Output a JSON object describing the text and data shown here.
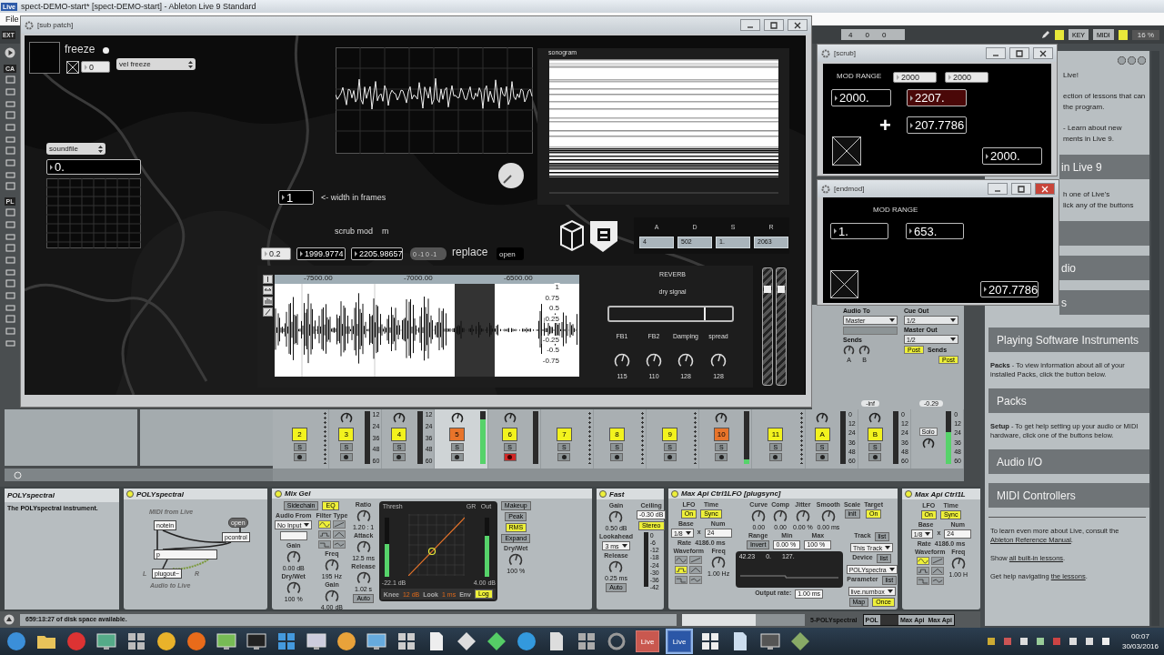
{
  "app": {
    "badge": "Live",
    "title": "spect-DEMO-start*  [spect-DEMO-start] - Ableton Live 9 Standard",
    "menu": [
      "File"
    ]
  },
  "control_bar": {
    "ext": "EXT",
    "counters": [
      "4",
      "0",
      "0"
    ],
    "key": "KEY",
    "midi": "MIDI",
    "cpu": "16 %"
  },
  "left_strip": {
    "labels": [
      "CA",
      "PL"
    ]
  },
  "sub_patch": {
    "title": "[sub patch]",
    "freeze": {
      "label": "freeze",
      "toggle": {
        "checked": true
      },
      "number": "0",
      "menu": "vel freeze"
    },
    "soundfile": {
      "menu": "soundfile",
      "number": "0."
    },
    "sonogram": {
      "label": "sonogram"
    },
    "width": {
      "number": "1",
      "label": "<- width in frames"
    },
    "scrub_mod": {
      "label": "scrub mod",
      "key": "m"
    },
    "numbers": [
      "0.2",
      "1999.9774",
      "2205.98657"
    ],
    "message": "0 -1 0 -1",
    "replace": "replace",
    "open": "open",
    "adsr": [
      {
        "label": "A",
        "value": "4"
      },
      {
        "label": "D",
        "value": "502"
      },
      {
        "label": "S",
        "value": "1."
      },
      {
        "label": "R",
        "value": "2063"
      }
    ],
    "waveform": {
      "ruler": [
        "-7500.00",
        "-7000.00",
        "-6500.00"
      ],
      "scale": [
        "1",
        "0.75",
        "0.5",
        "0.25",
        "-0.25",
        "-0.5",
        "-0.75"
      ]
    },
    "reverb": {
      "title": "REVERB",
      "slider_label": "dry signal",
      "level": 0.77,
      "knobs": [
        {
          "label": "FB1",
          "value": "115"
        },
        {
          "label": "FB2",
          "value": "110"
        },
        {
          "label": "Damping",
          "value": "128"
        },
        {
          "label": "spread",
          "value": "128"
        }
      ]
    },
    "faders": [
      {
        "level": 0.84
      },
      {
        "level": 0.84
      }
    ]
  },
  "scrub": {
    "title": "[scrub]",
    "label": "MOD RANGE",
    "inputs": [
      "2000",
      "2000"
    ],
    "operator": "+",
    "numbers": [
      {
        "value": "2000.",
        "selected": false
      },
      {
        "value": "2207.",
        "selected": true
      },
      {
        "value": "207.7786",
        "selected": false
      },
      {
        "value": "2000.",
        "selected": false
      }
    ]
  },
  "endmod": {
    "title": "[endmod]",
    "label": "MOD RANGE",
    "numbers": [
      "1.",
      "653.",
      "207.7786"
    ]
  },
  "mixer": {
    "io": {
      "audio_to": {
        "label": "Audio To",
        "value": "Master"
      },
      "sends": "Sends",
      "send_knobs": [
        "A",
        "B"
      ],
      "volume": "-inf",
      "cue_out": {
        "label": "Cue Out",
        "value": "1/2"
      },
      "master_out": {
        "label": "Master Out",
        "value": "1/2"
      },
      "post": [
        "Post",
        "Post"
      ],
      "master_sends": "Sends",
      "master_volume": "-0.29"
    },
    "tracks": [
      {
        "number": "2",
        "color": "#f2f21e",
        "selected": false,
        "armed": false,
        "solo": "S",
        "knob": false
      },
      {
        "number": "3",
        "color": "#f2f21e",
        "selected": false,
        "armed": false,
        "solo": "S",
        "knob": true,
        "level": 0,
        "scale": [
          "12",
          "24",
          "36",
          "48",
          "60"
        ]
      },
      {
        "number": "4",
        "color": "#f2f21e",
        "selected": false,
        "armed": false,
        "solo": "S",
        "knob": true,
        "level": 0,
        "scale": [
          "12",
          "24",
          "36",
          "48",
          "60"
        ]
      },
      {
        "number": "5",
        "color": "#e8742a",
        "selected": true,
        "armed": false,
        "solo": "S",
        "knob": true,
        "level": 0.85
      },
      {
        "number": "6",
        "color": "#f2f21e",
        "selected": false,
        "armed": true,
        "solo": "S",
        "knob": true,
        "level": 0
      },
      {
        "number": "7",
        "color": "#f2f21e",
        "selected": false,
        "armed": false,
        "solo": "S",
        "knob": false
      },
      {
        "number": "8",
        "color": "#f2f21e",
        "selected": false,
        "armed": false,
        "solo": "S",
        "knob": false
      },
      {
        "number": "9",
        "color": "#f2f21e",
        "selected": false,
        "armed": false,
        "solo": "S",
        "knob": false
      },
      {
        "number": "10",
        "color": "#e8742a",
        "selected": false,
        "armed": false,
        "solo": "S",
        "knob": true,
        "level": 0.08
      },
      {
        "number": "11",
        "color": "#f2f21e",
        "selected": false,
        "armed": false,
        "solo": "S",
        "knob": false
      },
      {
        "number": "A",
        "color": "#f2f21e",
        "selected": false,
        "armed": false,
        "solo": "S",
        "knob": true,
        "level": 0,
        "scale": [
          "0",
          "12",
          "24",
          "36",
          "48",
          "60"
        ]
      },
      {
        "number": "B",
        "color": "#f2f21e",
        "selected": false,
        "armed": false,
        "solo": "S",
        "knob": true,
        "level": 0,
        "scale": [
          "0",
          "12",
          "24",
          "36",
          "48",
          "60"
        ]
      }
    ],
    "master": {
      "solo": "Solo",
      "level": 0.6,
      "scale": [
        "0",
        "12",
        "24",
        "36",
        "48",
        "60"
      ]
    }
  },
  "help": {
    "upper": [
      {
        "kind": "text",
        "lines": [
          "Live!"
        ]
      },
      {
        "kind": "text",
        "lines": [
          "ection of lessons that can",
          "the program."
        ]
      },
      {
        "kind": "text",
        "lines": [
          "- Learn about new",
          "ments in Live 9."
        ]
      },
      {
        "kind": "header",
        "text": "in Live 9"
      },
      {
        "kind": "text",
        "lines": [
          "h one of Live's",
          "lick any of the buttons"
        ]
      },
      {
        "kind": "header"
      },
      {
        "kind": "header",
        "text": "dio"
      },
      {
        "kind": "header",
        "text": "s"
      }
    ],
    "lower": [
      {
        "kind": "header",
        "text": "Playing Software Instruments"
      },
      {
        "kind": "para",
        "text": "**Packs** - To view information about all of your installed Packs, click the button below."
      },
      {
        "kind": "header",
        "text": "Packs"
      },
      {
        "kind": "para",
        "text": "**Setup** - To get help setting up your audio or MIDI hardware, click one of the buttons below."
      },
      {
        "kind": "header",
        "text": "Audio I/O"
      },
      {
        "kind": "header",
        "text": "MIDI Controllers"
      },
      {
        "kind": "link",
        "before": "To learn even more about Live, consult the",
        "link": "Ableton Reference Manual",
        "after": "."
      },
      {
        "kind": "link",
        "before": "Show",
        "link": "all built-in lessons",
        "after": "."
      },
      {
        "kind": "link",
        "before": "Get help navigating",
        "link": "the lessons",
        "after": "."
      }
    ]
  },
  "devices": {
    "info": {
      "title": "POLYspectral",
      "text": "The POLYspectral instrument."
    },
    "list": [
      {
        "title": "POLYspectral",
        "body": {
          "kind": "patch",
          "objects": [
            "MIDI from Live",
            "notein",
            "open",
            "pcontrol",
            "p",
            "L",
            "plugout~",
            "R",
            "Audio to Live"
          ]
        }
      },
      {
        "title": "Mix Gel",
        "body": {
          "kind": "row",
          "items": [
            {
              "kind": "stack",
              "items": [
                {
                  "kind": "row",
                  "items": [
                    {
                      "kind": "button",
                      "text": "Sidechain",
                      "on": false
                    },
                    {
                      "kind": "button",
                      "text": "EQ",
                      "on": true
                    }
                  ]
                },
                {
                  "kind": "row",
                  "items": [
                    {
                      "kind": "stack",
                      "items": [
                        {
                          "kind": "label",
                          "text": "Audio From"
                        },
                        {
                          "kind": "menu",
                          "value": "No Input"
                        },
                        {
                          "kind": "field"
                        },
                        {
                          "kind": "label",
                          "text": "Gain"
                        },
                        {
                          "kind": "knob",
                          "value": "0.00 dB"
                        },
                        {
                          "kind": "label",
                          "text": "Dry/Wet"
                        },
                        {
                          "kind": "knob",
                          "value": "100 %"
                        }
                      ]
                    },
                    {
                      "kind": "stack",
                      "items": [
                        {
                          "kind": "label",
                          "text": "Filter Type"
                        },
                        {
                          "kind": "icons",
                          "buttons": [
                            {
                              "selected": true
                            },
                            {
                              "selected": false
                            },
                            {
                              "selected": false
                            },
                            {
                              "selected": false
                            },
                            {
                              "selected": false
                            },
                            {
                              "selected": false
                            }
                          ]
                        },
                        {
                          "kind": "label",
                          "text": "Freq"
                        },
                        {
                          "kind": "knob",
                          "value": "195 Hz"
                        },
                        {
                          "kind": "label",
                          "text": "Gain"
                        },
                        {
                          "kind": "knob",
                          "value": "4.00 dB"
                        }
                      ]
                    }
                  ]
                }
              ]
            },
            {
              "kind": "stack",
              "items": [
                {
                  "kind": "label",
                  "text": "Ratio"
                },
                {
                  "kind": "knob",
                  "value": "1.20 : 1"
                },
                {
                  "kind": "label",
                  "text": "Attack"
                },
                {
                  "kind": "knob",
                  "value": "12.5 ms"
                },
                {
                  "kind": "label",
                  "text": "Release"
                },
                {
                  "kind": "knob",
                  "value": "1.02 s"
                },
                {
                  "kind": "button",
                  "text": "Auto",
                  "on": false
                }
              ]
            },
            {
              "kind": "graph",
              "labels": [
                "Thresh",
                "GR",
                "Out"
              ],
              "in_value": "-22.1 dB",
              "out_value": "4.00 dB",
              "meters": [
                {
                  "level": 0.55
                },
                {
                  "level": 0.7
                }
              ],
              "footer": [
                {
                  "kind": "label",
                  "text": "Knee"
                },
                {
                  "kind": "value",
                  "text": "12 dB"
                },
                {
                  "kind": "label",
                  "text": "Look"
                },
                {
                  "kind": "value",
                  "text": "1 ms"
                },
                {
                  "kind": "label",
                  "text": "Env"
                },
                {
                  "kind": "button",
                  "text": "Log",
                  "on": true
                }
              ]
            },
            {
              "kind": "stack",
              "items": [
                {
                  "kind": "button",
                  "text": "Makeup",
                  "on": false
                },
                {
                  "kind": "button",
                  "text": "Peak",
                  "on": false
                },
                {
                  "kind": "button",
                  "text": "RMS",
                  "on": true
                },
                {
                  "kind": "button",
                  "text": "Expand",
                  "on": false
                },
                {
                  "kind": "label",
                  "text": "Dry/Wet"
                },
                {
                  "kind": "knob",
                  "value": "100 %"
                }
              ]
            }
          ]
        }
      },
      {
        "title": "Fast",
        "body": {
          "kind": "row",
          "items": [
            {
              "kind": "stack",
              "items": [
                {
                  "kind": "label",
                  "text": "Gain"
                },
                {
                  "kind": "knob",
                  "value": "0.50 dB"
                },
                {
                  "kind": "label",
                  "text": "Lookahead"
                },
                {
                  "kind": "menu",
                  "value": "3 ms"
                },
                {
                  "kind": "label",
                  "text": "Release"
                },
                {
                  "kind": "knob",
                  "value": "0.25 ms"
                },
                {
                  "kind": "button",
                  "text": "Auto",
                  "on": false
                }
              ]
            },
            {
              "kind": "stack",
              "items": [
                {
                  "kind": "label",
                  "text": "Ceiling"
                },
                {
                  "kind": "field",
                  "value": "-0.30 dB"
                },
                {
                  "kind": "button",
                  "text": "Stereo",
                  "on": true
                },
                {
                  "kind": "meter",
                  "level": 0,
                  "scale": [
                    "0",
                    "-6",
                    "-12",
                    "-18",
                    "-24",
                    "-30",
                    "-36",
                    "-42"
                  ]
                }
              ]
            }
          ]
        }
      },
      {
        "title": "Max Api Ctrl1LFO [plugsync]",
        "body": {
          "kind": "row",
          "items": [
            {
              "kind": "stack",
              "items": [
                {
                  "kind": "row",
                  "items": [
                    {
                      "kind": "stack",
                      "items": [
                        {
                          "kind": "label",
                          "text": "LFO"
                        },
                        {
                          "kind": "button",
                          "text": "On",
                          "on": true
                        }
                      ]
                    },
                    {
                      "kind": "stack",
                      "items": [
                        {
                          "kind": "label",
                          "text": "Time"
                        },
                        {
                          "kind": "button",
                          "text": "Sync",
                          "on": true
                        }
                      ]
                    }
                  ]
                },
                {
                  "kind": "row",
                  "items": [
                    {
                      "kind": "stack",
                      "items": [
                        {
                          "kind": "label",
                          "text": "Base"
                        },
                        {
                          "kind": "row",
                          "items": [
                            {
                              "kind": "menu",
                              "value": "1/8"
                            },
                            {
                              "kind": "label",
                              "text": "x"
                            }
                          ]
                        }
                      ]
                    },
                    {
                      "kind": "stack",
                      "items": [
                        {
                          "kind": "label",
                          "text": "Num"
                        },
                        {
                          "kind": "field",
                          "value": "24"
                        }
                      ]
                    }
                  ]
                },
                {
                  "kind": "row",
                  "items": [
                    {
                      "kind": "label",
                      "text": "Rate"
                    },
                    {
                      "kind": "label",
                      "text": "4186.0 ms"
                    }
                  ]
                },
                {
                  "kind": "row",
                  "items": [
                    {
                      "kind": "stack",
                      "items": [
                        {
                          "kind": "label",
                          "text": "Waveform"
                        },
                        {
                          "kind": "icons",
                          "buttons": [
                            {
                              "selected": false
                            },
                            {
                              "selected": false
                            },
                            {
                              "selected": true
                            },
                            {
                              "selected": false
                            },
                            {
                              "selected": false
                            },
                            {
                              "selected": false
                            }
                          ]
                        }
                      ]
                    },
                    {
                      "kind": "stack",
                      "items": [
                        {
                          "kind": "label",
                          "text": "Freq"
                        },
                        {
                          "kind": "knob",
                          "value": "1.00 Hz"
                        }
                      ]
                    }
                  ]
                }
              ]
            },
            {
              "kind": "stack",
              "items": [
                {
                  "kind": "row",
                  "items": [
                    {
                      "kind": "stack",
                      "items": [
                        {
                          "kind": "label",
                          "text": "Curve"
                        },
                        {
                          "kind": "knob",
                          "value": "0.00"
                        }
                      ]
                    },
                    {
                      "kind": "stack",
                      "items": [
                        {
                          "kind": "label",
                          "text": "Comp"
                        },
                        {
                          "kind": "knob",
                          "value": "0.00"
                        }
                      ]
                    },
                    {
                      "kind": "stack",
                      "items": [
                        {
                          "kind": "label",
                          "text": "Jitter"
                        },
                        {
                          "kind": "knob",
                          "value": "0.00 %"
                        }
                      ]
                    },
                    {
                      "kind": "stack",
                      "items": [
                        {
                          "kind": "label",
                          "text": "Smooth"
                        },
                        {
                          "kind": "knob",
                          "value": "0.00 ms"
                        }
                      ]
                    },
                    {
                      "kind": "stack",
                      "items": [
                        {
                          "kind": "label",
                          "text": "Scale"
                        },
                        {
                          "kind": "button",
                          "text": "init",
                          "on": false
                        }
                      ]
                    },
                    {
                      "kind": "stack",
                      "items": [
                        {
                          "kind": "label",
                          "text": "Target"
                        },
                        {
                          "kind": "button",
                          "text": "On",
                          "on": true
                        }
                      ]
                    }
                  ]
                },
                {
                  "kind": "row",
                  "items": [
                    {
                      "kind": "stack",
                      "items": [
                        {
                          "kind": "row",
                          "items": [
                            {
                              "kind": "stack",
                              "items": [
                                {
                                  "kind": "label",
                                  "text": "Range"
                                },
                                {
                                  "kind": "button",
                                  "text": "Invert",
                                  "on": false
                                }
                              ]
                            },
                            {
                              "kind": "stack",
                              "items": [
                                {
                                  "kind": "label",
                                  "text": "Min"
                                },
                                {
                                  "kind": "field",
                                  "value": "0.00 %"
                                }
                              ]
                            },
                            {
                              "kind": "stack",
                              "items": [
                                {
                                  "kind": "label",
                                  "text": "Max"
                                },
                                {
                                  "kind": "field",
                                  "value": "100 %"
                                }
                              ]
                            }
                          ]
                        },
                        {
                          "kind": "display",
                          "values": [
                            "42.23",
                            "0.",
                            "127."
                          ]
                        },
                        {
                          "kind": "row",
                          "items": [
                            {
                              "kind": "label",
                              "text": "Output rate:"
                            },
                            {
                              "kind": "field",
                              "value": "1.00 ms"
                            }
                          ]
                        }
                      ]
                    },
                    {
                      "kind": "stack",
                      "items": [
                        {
                          "kind": "row",
                          "items": [
                            {
                              "kind": "label",
                              "text": "Track"
                            },
                            {
                              "kind": "button",
                              "text": "list",
                              "on": false
                            }
                          ]
                        },
                        {
                          "kind": "menu",
                          "value": "This Track"
                        },
                        {
                          "kind": "row",
                          "items": [
                            {
                              "kind": "label",
                              "text": "Device"
                            },
                            {
                              "kind": "button",
                              "text": "list",
                              "on": false
                            }
                          ]
                        },
                        {
                          "kind": "menu",
                          "value": "POLYspectra"
                        },
                        {
                          "kind": "row",
                          "items": [
                            {
                              "kind": "label",
                              "text": "Parameter"
                            },
                            {
                              "kind": "button",
                              "text": "list",
                              "on": false
                            }
                          ]
                        },
                        {
                          "kind": "menu",
                          "value": "live.numbox"
                        },
                        {
                          "kind": "row",
                          "items": [
                            {
                              "kind": "button",
                              "text": "Map",
                              "on": false
                            },
                            {
                              "kind": "button",
                              "text": "Once",
                              "on": true
                            }
                          ]
                        }
                      ]
                    }
                  ]
                }
              ]
            }
          ]
        }
      },
      {
        "title": "Max Api Ctrl1L",
        "body": {
          "kind": "stack",
          "items": [
            {
              "kind": "row",
              "items": [
                {
                  "kind": "stack",
                  "items": [
                    {
                      "kind": "label",
                      "text": "LFO"
                    },
                    {
                      "kind": "button",
                      "text": "On",
                      "on": true
                    }
                  ]
                },
                {
                  "kind": "stack",
                  "items": [
                    {
                      "kind": "label",
                      "text": "Time"
                    },
                    {
                      "kind": "button",
                      "text": "Sync",
                      "on": true
                    }
                  ]
                }
              ]
            },
            {
              "kind": "row",
              "items": [
                {
                  "kind": "stack",
                  "items": [
                    {
                      "kind": "label",
                      "text": "Base"
                    },
                    {
                      "kind": "row",
                      "items": [
                        {
                          "kind": "menu",
                          "value": "1/8"
                        },
                        {
                          "kind": "label",
                          "text": "x"
                        }
                      ]
                    }
                  ]
                },
                {
                  "kind": "stack",
                  "items": [
                    {
                      "kind": "label",
                      "text": "Num"
                    },
                    {
                      "kind": "field",
                      "value": "24"
                    }
                  ]
                }
              ]
            },
            {
              "kind": "row",
              "items": [
                {
                  "kind": "label",
                  "text": "Rate"
                },
                {
                  "kind": "label",
                  "text": "4186.0 ms"
                }
              ]
            },
            {
              "kind": "row",
              "items": [
                {
                  "kind": "stack",
                  "items": [
                    {
                      "kind": "label",
                      "text": "Waveform"
                    },
                    {
                      "kind": "icons",
                      "buttons": [
                        {
                          "selected": true
                        },
                        {
                          "selected": false
                        },
                        {
                          "selected": false
                        },
                        {
                          "selected": false
                        },
                        {
                          "selected": false
                        },
                        {
                          "selected": false
                        }
                      ]
                    }
                  ]
                },
                {
                  "kind": "stack",
                  "items": [
                    {
                      "kind": "label",
                      "text": "Freq"
                    },
                    {
                      "kind": "knob",
                      "value": "1.00 H"
                    }
                  ]
                }
              ]
            }
          ]
        }
      }
    ]
  },
  "status_bar": {
    "message": "659:13:27 of disk space available.",
    "track": "5-POLYspectral",
    "chain": [
      "POL",
      "Max Api",
      "Max Api"
    ]
  },
  "taskbar": {
    "apps": [
      {
        "label": "Live",
        "selected": false
      },
      {
        "label": "Live",
        "selected": true
      }
    ],
    "time": "00:07",
    "date": "30/03/2016"
  }
}
